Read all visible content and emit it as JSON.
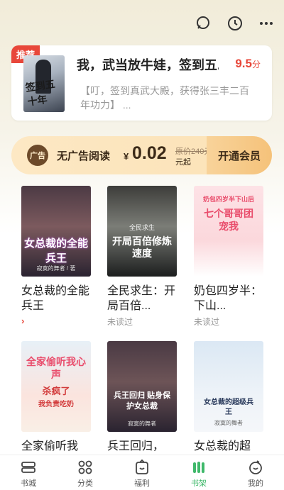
{
  "header": {
    "icons": [
      "search-icon",
      "history-icon",
      "more-icon"
    ]
  },
  "recommend": {
    "badge": "推荐",
    "title": "我，武当放牛娃，签到五...",
    "score": "9.5",
    "score_unit": "分",
    "desc": "【叮，签到真武大殿，获得张三丰二百年功力】 ...",
    "cover_text": "签到五十年"
  },
  "vip": {
    "icon_text": "广告",
    "label": "无广告阅读",
    "yen": "¥",
    "price": "0.02",
    "orig_price": "原价240元",
    "unit": "元起",
    "button": "开通会员"
  },
  "books": [
    {
      "title": "女总裁的全能兵王",
      "sub": "›",
      "sub_type": "arrow",
      "cover_text": "女总裁的全能兵王",
      "cover_author": "寂寞的舞者 / 著"
    },
    {
      "title": "全民求生：开局百倍...",
      "sub": "未读过",
      "sub_type": "plain",
      "cover_text": "开局百倍修炼速度",
      "cover_top": "全民求生"
    },
    {
      "title": "奶包四岁半：下山...",
      "sub": "未读过",
      "sub_type": "plain",
      "cover_text": "七个哥哥团宠我",
      "cover_top": "奶包四岁半下山后"
    },
    {
      "title": "全家偷听我",
      "sub": "",
      "sub_type": "plain",
      "cover_text": "全家偷听我心声",
      "cover_mid": "杀疯了",
      "cover_bot": "我负责吃奶"
    },
    {
      "title": "兵王回归，",
      "sub": "",
      "sub_type": "plain",
      "cover_text": "兵王回归 贴身保护女总裁",
      "cover_author": "寂寞的舞者"
    },
    {
      "title": "女总裁的超",
      "sub": "",
      "sub_type": "plain",
      "cover_text": "女总裁的超级兵王",
      "cover_author": "寂寞的舞者"
    }
  ],
  "tabs": [
    {
      "label": "书城",
      "icon": "bookstore-icon",
      "active": false
    },
    {
      "label": "分类",
      "icon": "category-icon",
      "active": false
    },
    {
      "label": "福利",
      "icon": "welfare-icon",
      "active": false
    },
    {
      "label": "书架",
      "icon": "bookshelf-icon",
      "active": true
    },
    {
      "label": "我的",
      "icon": "profile-icon",
      "active": false
    }
  ],
  "colors": {
    "accent": "#e8473a",
    "active_tab": "#3fb86a",
    "vip_bg": "#fbe2b6"
  }
}
